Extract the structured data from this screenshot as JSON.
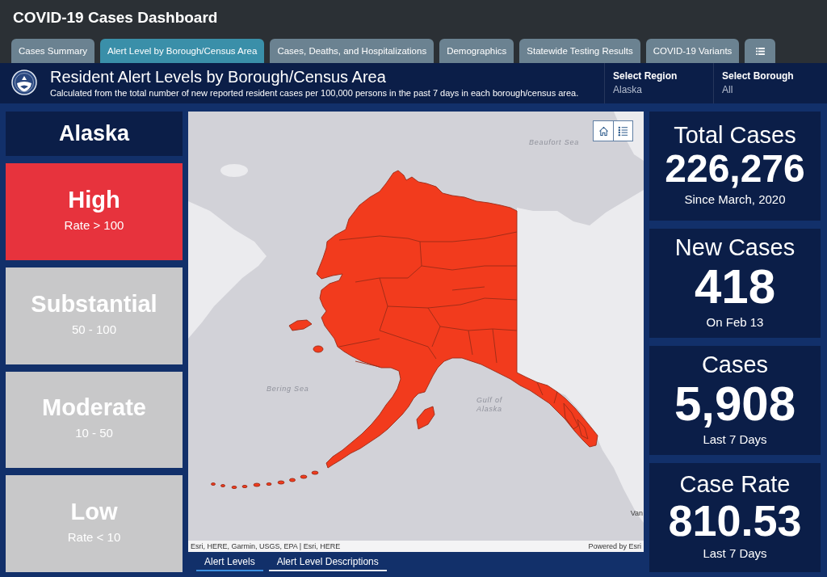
{
  "header": {
    "title": "COVID-19 Cases Dashboard"
  },
  "tabs": [
    {
      "kind": "text",
      "label": "Cases Summary",
      "selected": false
    },
    {
      "kind": "text",
      "label": "Alert Level by Borough/Census Area",
      "selected": true
    },
    {
      "kind": "text",
      "label": "Cases, Deaths, and Hospitalizations",
      "selected": false
    },
    {
      "kind": "text",
      "label": "Demographics",
      "selected": false
    },
    {
      "kind": "text",
      "label": "Statewide Testing Results",
      "selected": false
    },
    {
      "kind": "text",
      "label": "COVID-19 Variants",
      "selected": false
    },
    {
      "kind": "menu",
      "selected": false
    }
  ],
  "banner": {
    "title": "Resident Alert Levels by Borough/Census Area",
    "subtitle": "Calculated from the total number of new reported resident cases per 100,000 persons in the past 7 days in each borough/census area.",
    "selectors": [
      {
        "label": "Select Region",
        "value": "Alaska"
      },
      {
        "label": "Select Borough",
        "value": "All"
      }
    ]
  },
  "region_card": {
    "name": "Alaska"
  },
  "alert_levels": [
    {
      "name": "High",
      "range": "Rate > 100",
      "selected": true
    },
    {
      "name": "Substantial",
      "range": "50 - 100",
      "selected": false
    },
    {
      "name": "Moderate",
      "range": "10 - 50",
      "selected": false
    },
    {
      "name": "Low",
      "range": "Rate < 10",
      "selected": false
    }
  ],
  "map": {
    "labels": [
      {
        "kind": "water",
        "text": "Beaufort Sea"
      },
      {
        "kind": "water",
        "text": "Bering Sea"
      },
      {
        "kind": "water",
        "text": "Gulf of Alaska"
      },
      {
        "kind": "city",
        "text": "Van"
      }
    ],
    "attribution": "Esri, HERE, Garmin, USGS, EPA | Esri, HERE",
    "powered_by": "Powered by Esri"
  },
  "map_tabs": [
    {
      "label": "Alert Levels",
      "selected": true
    },
    {
      "label": "Alert Level Descriptions",
      "selected": false
    }
  ],
  "stats": [
    {
      "title": "Total Cases",
      "value": "226,276",
      "note": "Since March, 2020"
    },
    {
      "title": "New Cases",
      "value": "418",
      "note": "On Feb 13"
    },
    {
      "title": "Cases",
      "value": "5,908",
      "note": "Last 7 Days"
    },
    {
      "title": "Case Rate",
      "value": "810.53",
      "note": "Last 7 Days"
    }
  ]
}
